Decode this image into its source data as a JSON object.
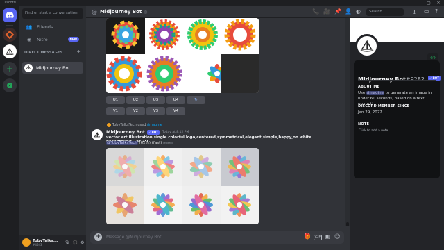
{
  "window": {
    "title": "Discord",
    "controls": [
      "—",
      "▢",
      "✕"
    ]
  },
  "sidebar": {
    "search_placeholder": "Find or start a conversation",
    "nav": [
      {
        "label": "Friends"
      },
      {
        "label": "Nitro",
        "badge": "NEW"
      }
    ],
    "dm_header": "DIRECT MESSAGES",
    "dm_add": "+",
    "dms": [
      {
        "label": "Midjourney Bot"
      }
    ]
  },
  "user_panel": {
    "name": "TobyTalks...",
    "tag": "#4643"
  },
  "header": {
    "channel": "Midjourney Bot",
    "search_placeholder": "Search"
  },
  "messages": {
    "buttons_row1": [
      "U1",
      "U2",
      "U3",
      "U4",
      "↻"
    ],
    "buttons_row2": [
      "V1",
      "V2",
      "V3",
      "V4"
    ],
    "reply": {
      "user": "TobyTalksTech",
      "verb": "used",
      "command": "/imagine"
    },
    "author": "Midjourney Bot",
    "bot_badge": "✓ BOT",
    "timestamp": "Today at 8:12 PM",
    "prompt": "vector art illustration,single colorful logo,centered,symmetrical,elegant,simple,happy,on white background --ar 2:1",
    "mention": "@TobyTalksTech",
    "progress": "(62%) (fast)",
    "status_small": "(edited)"
  },
  "composer": {
    "placeholder": "Message @Midjourney Bot"
  },
  "profile": {
    "name": "Midjourney Bot",
    "discriminator": "#9282",
    "badge": "✓ BOT",
    "about_title": "ABOUT ME",
    "about_prefix": "Use",
    "about_command": "/imagine",
    "about_suffix": "to generate an image in under 60 seconds, based on a text prompt!",
    "member_title": "DISCORD MEMBER SINCE",
    "member_since": "Jan 29, 2022",
    "note_title": "NOTE",
    "note_placeholder": "Click to add a note",
    "code_icon": "{/}"
  },
  "colors": {
    "accent": "#5865f2",
    "bg": "#313338",
    "sidebar": "#2b2d31",
    "guildbar": "#1e1f22"
  }
}
